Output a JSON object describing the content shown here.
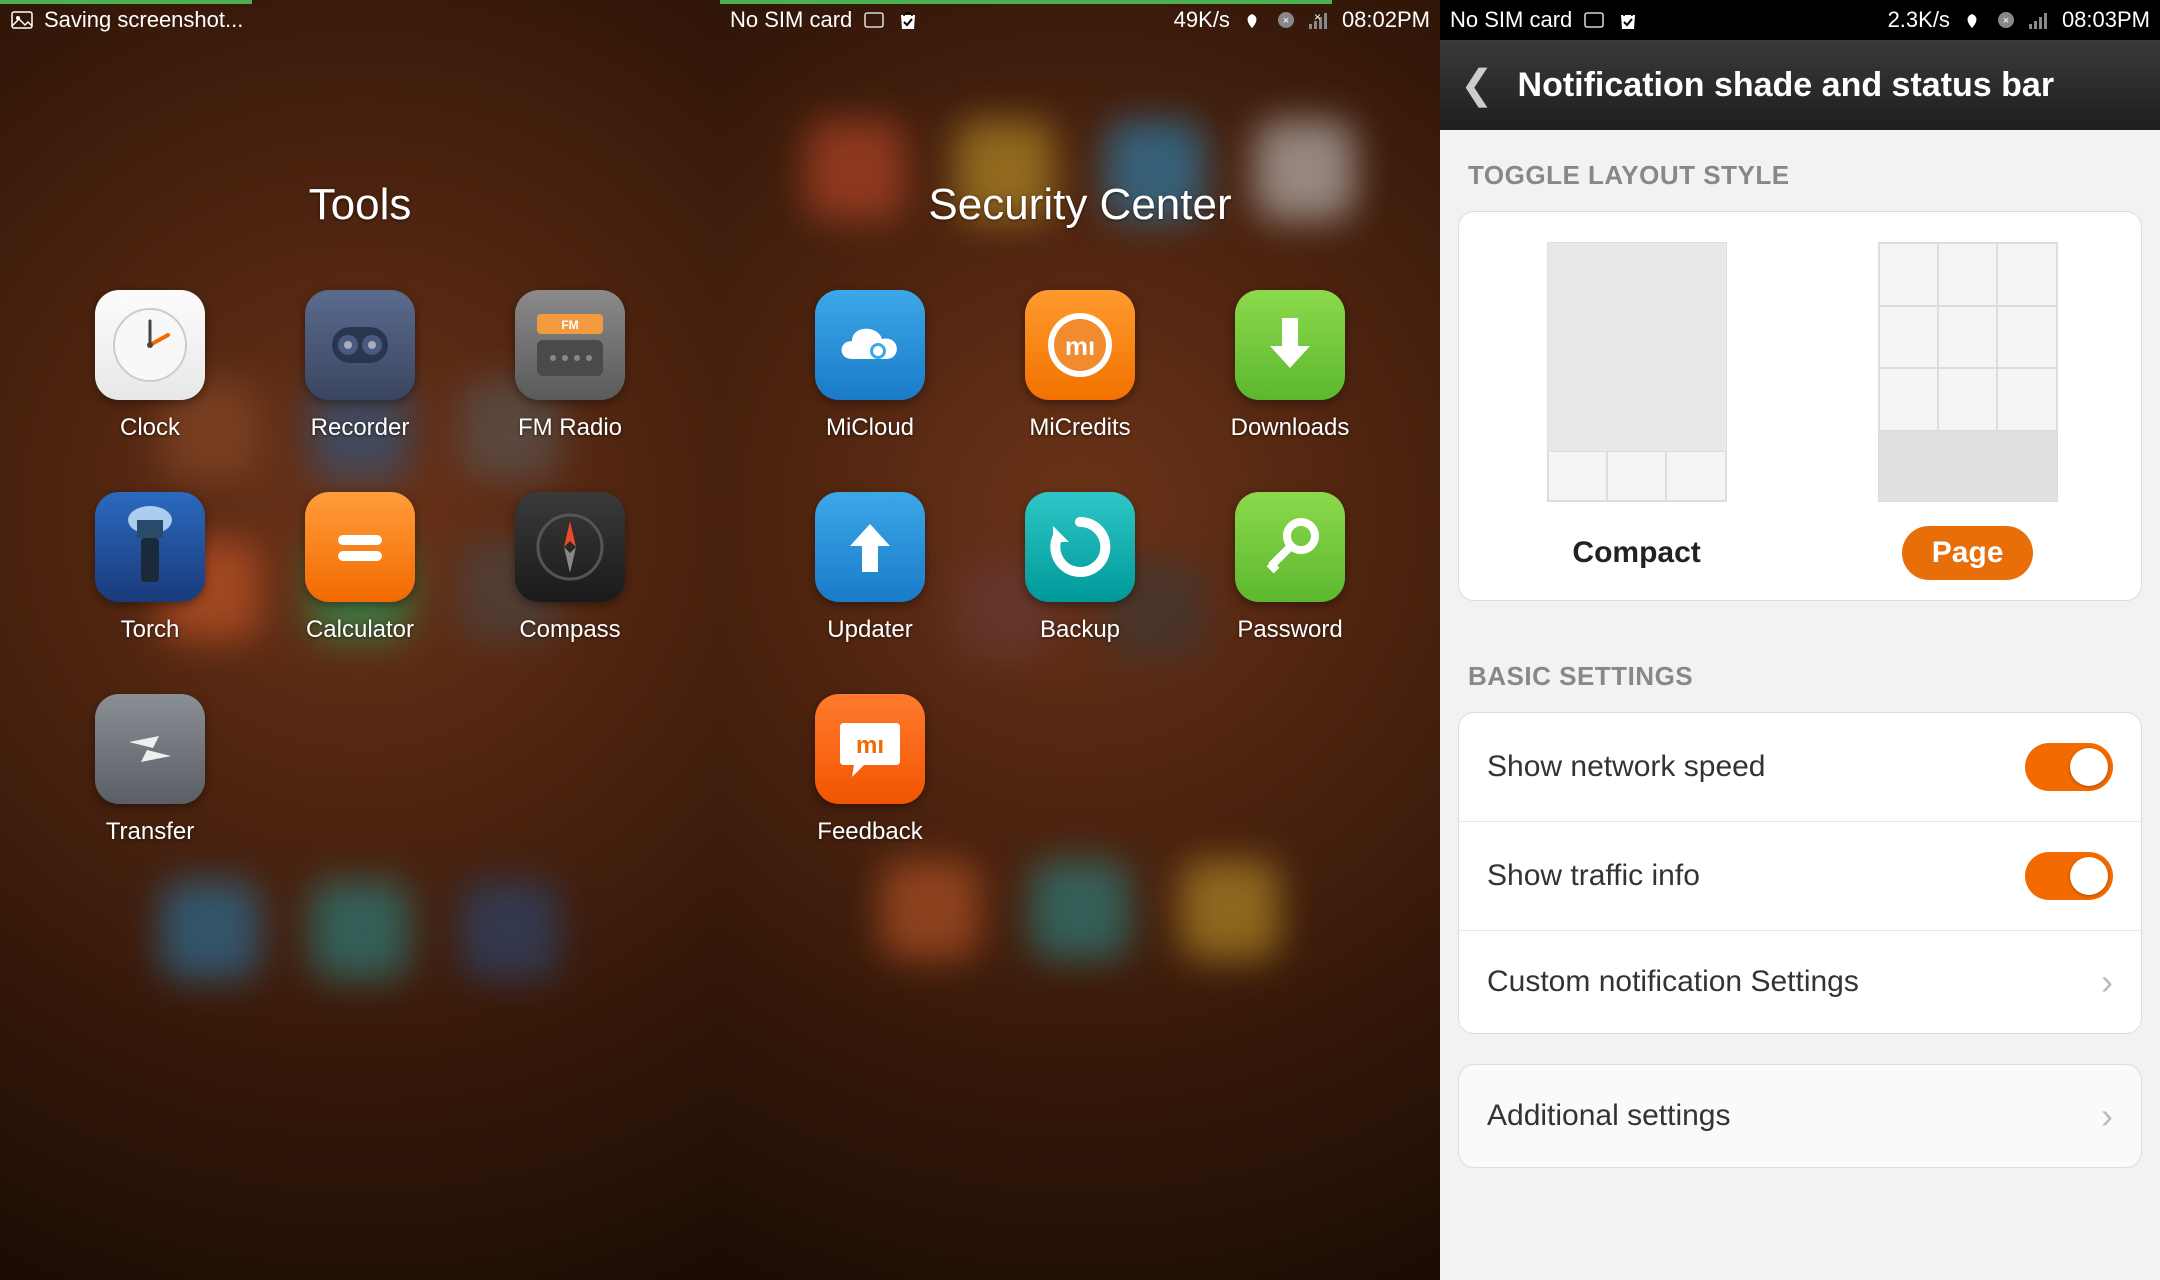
{
  "screen1": {
    "statusbar": {
      "left": "Saving screenshot...",
      "green_line_pct": 35
    },
    "folder_title": "Tools",
    "apps": [
      {
        "id": "clock",
        "label": "Clock"
      },
      {
        "id": "recorder",
        "label": "Recorder"
      },
      {
        "id": "fmradio",
        "label": "FM Radio"
      },
      {
        "id": "torch",
        "label": "Torch"
      },
      {
        "id": "calculator",
        "label": "Calculator"
      },
      {
        "id": "compass",
        "label": "Compass"
      },
      {
        "id": "transfer",
        "label": "Transfer"
      }
    ]
  },
  "screen2": {
    "statusbar": {
      "sim": "No SIM card",
      "speed": "49K/s",
      "time": "08:02PM",
      "green_line_pct": 85
    },
    "folder_title": "Security Center",
    "apps": [
      {
        "id": "micloud",
        "label": "MiCloud"
      },
      {
        "id": "micredits",
        "label": "MiCredits"
      },
      {
        "id": "downloads",
        "label": "Downloads"
      },
      {
        "id": "updater",
        "label": "Updater"
      },
      {
        "id": "backup",
        "label": "Backup"
      },
      {
        "id": "password",
        "label": "Password"
      },
      {
        "id": "feedback",
        "label": "Feedback"
      }
    ]
  },
  "screen3": {
    "statusbar": {
      "sim": "No SIM card",
      "speed": "2.3K/s",
      "time": "08:03PM",
      "green_line_pct": 40
    },
    "header_title": "Notification shade and status bar",
    "sections": {
      "toggle_layout": {
        "label": "TOGGLE LAYOUT STYLE",
        "option_compact": "Compact",
        "option_page": "Page",
        "selected": "Page"
      },
      "basic": {
        "label": "BASIC SETTINGS",
        "rows": [
          {
            "label": "Show network speed",
            "type": "toggle",
            "on": true
          },
          {
            "label": "Show traffic info",
            "type": "toggle",
            "on": true
          },
          {
            "label": "Custom notification Settings",
            "type": "nav"
          }
        ]
      },
      "additional": {
        "label": "Additional settings"
      }
    }
  }
}
